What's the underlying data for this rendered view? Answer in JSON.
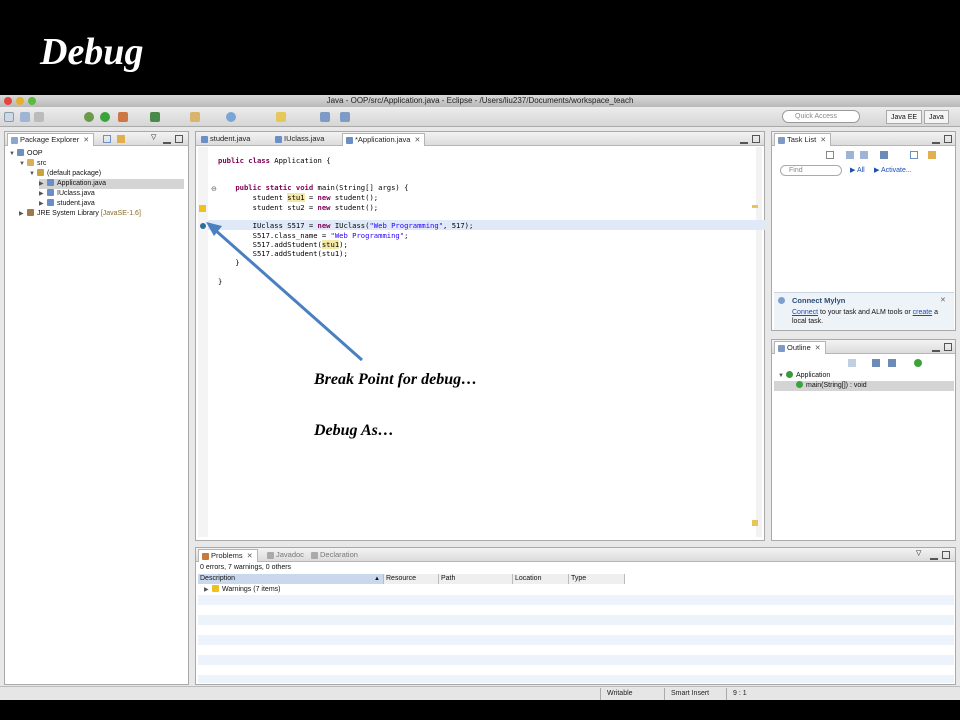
{
  "slide": {
    "title": "Debug",
    "annotation_breakpoint": "Break Point for debug…",
    "annotation_debug_as": "Debug As…"
  },
  "window": {
    "title": "Java - OOP/src/Application.java - Eclipse - /Users/liu237/Documents/workspace_teach",
    "quick_access_placeholder": "Quick Access",
    "perspectives": [
      "Java EE",
      "Java"
    ]
  },
  "package_explorer": {
    "tab_label": "Package Explorer",
    "tree": [
      {
        "label": "OOP",
        "level": 0
      },
      {
        "label": "src",
        "level": 1
      },
      {
        "label": "(default package)",
        "level": 2
      },
      {
        "label": "Application.java",
        "level": 3,
        "selected": true
      },
      {
        "label": "IUclass.java",
        "level": 3
      },
      {
        "label": "student.java",
        "level": 3
      },
      {
        "label": "JRE System Library",
        "suffix": "[JavaSE-1.6]",
        "level": 1
      }
    ]
  },
  "editor": {
    "tabs": [
      "student.java",
      "IUclass.java",
      "*Application.java"
    ],
    "active_tab": 2,
    "lines": [
      {
        "text": "public class Application {"
      },
      {
        "text": ""
      },
      {
        "text": "    public static void main(String[] args) {"
      },
      {
        "text": "        student stu1 = new student();"
      },
      {
        "text": "        student stu2 = new student();"
      },
      {
        "text": ""
      },
      {
        "text": "        IUclass S517 = new IUclass(\"Web Programming\", 517);"
      },
      {
        "text": "        S517.class_name = \"Web Programming\";"
      },
      {
        "text": "        S517.addStudent(stu1);"
      },
      {
        "text": "        S517.addStudent(stu1);"
      },
      {
        "text": "    }"
      },
      {
        "text": ""
      },
      {
        "text": "}"
      }
    ]
  },
  "task_list": {
    "tab_label": "Task List",
    "find_placeholder": "Find",
    "all_label": "All",
    "activate_label": "Activate..."
  },
  "mylyn": {
    "title": "Connect Mylyn",
    "connect_link": "Connect",
    "text_mid": "to your task and ALM tools or",
    "create_link": "create",
    "text_end": "a local task."
  },
  "outline": {
    "tab_label": "Outline",
    "items": [
      "Application",
      "main(String[]) : void"
    ]
  },
  "problems": {
    "tabs": [
      "Problems",
      "Javadoc",
      "Declaration"
    ],
    "summary": "0 errors, 7 warnings, 0 others",
    "columns": [
      "Description",
      "Resource",
      "Path",
      "Location",
      "Type"
    ],
    "rows": [
      "Warnings (7 items)"
    ]
  },
  "statusbar": {
    "mode": "Writable",
    "insert": "Smart Insert",
    "position": "9 : 1"
  },
  "colors": {
    "keyword": "#7f0055",
    "string": "#2a00ff",
    "arrow": "#4a7fc1",
    "link": "#1a4fb0"
  }
}
